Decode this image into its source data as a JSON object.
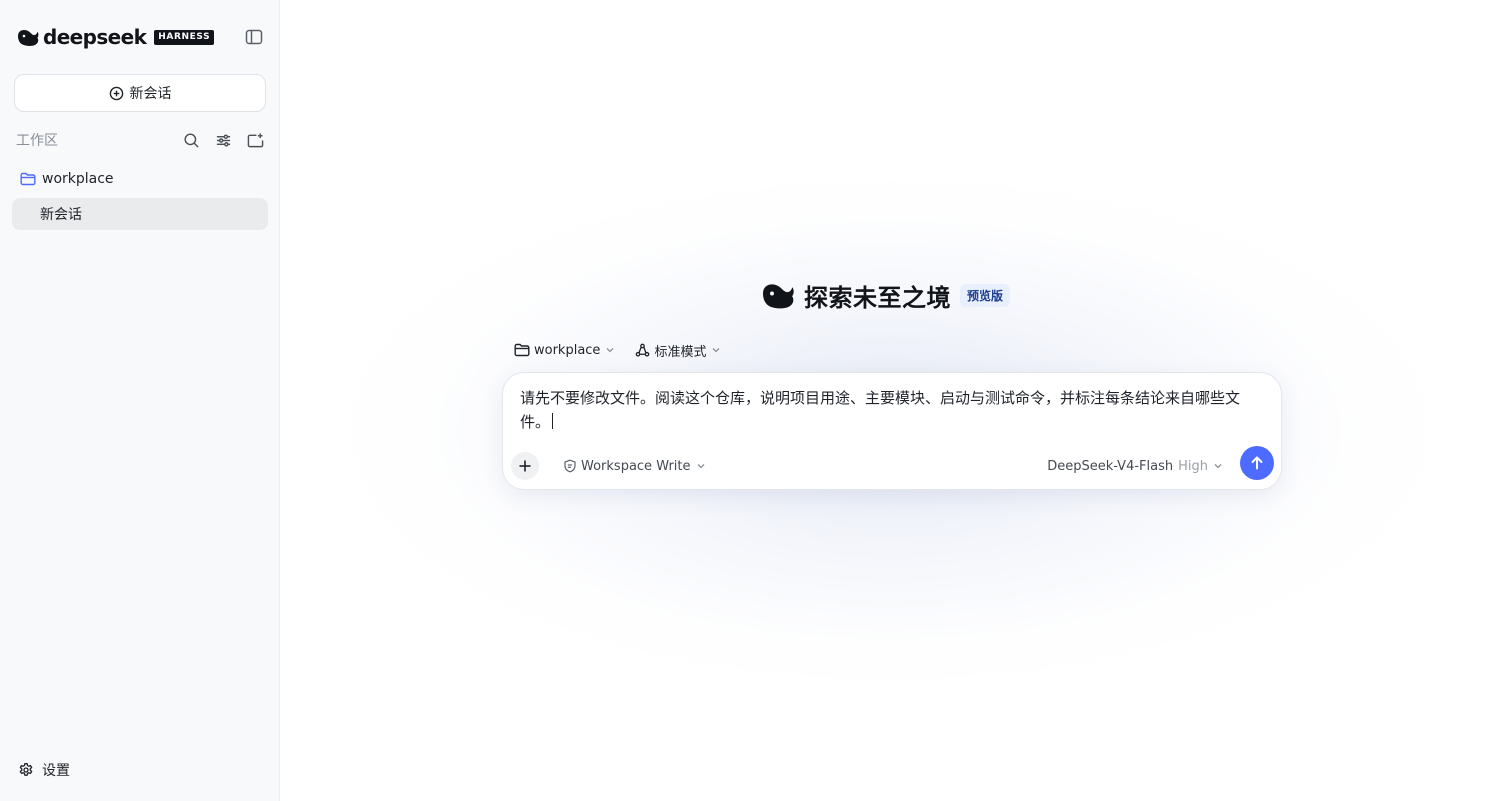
{
  "sidebar": {
    "brand": {
      "name": "deepseek",
      "badge": "HARNESS"
    },
    "new_chat_label": "新会话",
    "workspace_label": "工作区",
    "folders": [
      {
        "name": "workplace",
        "sessions": [
          "新会话"
        ]
      }
    ],
    "settings_label": "设置"
  },
  "main": {
    "hero_title": "探索未至之境",
    "hero_badge": "预览版",
    "folder_selector": "workplace",
    "mode_selector": "标准模式",
    "composer": {
      "text": "请先不要修改文件。阅读这个仓库，说明项目用途、主要模块、启动与测试命令，并标注每条结论来自哪些文件。",
      "permission": "Workspace Write",
      "model": "DeepSeek-V4-Flash",
      "level": "High"
    }
  },
  "colors": {
    "accent": "#4d6bfe",
    "sidebar_bg": "#f8f9fa",
    "selected_item_bg": "#eaebed",
    "badge_bg": "#e8efff",
    "badge_text": "#1d3e8f"
  },
  "icons": [
    "deepseek-whale-icon",
    "sidebar-toggle-icon",
    "plus-circle-icon",
    "search-icon",
    "filter-icon",
    "new-folder-icon",
    "folder-icon",
    "gear-icon",
    "chevron-down-icon",
    "mode-icon",
    "shield-icon",
    "plus-icon",
    "arrow-up-icon"
  ]
}
